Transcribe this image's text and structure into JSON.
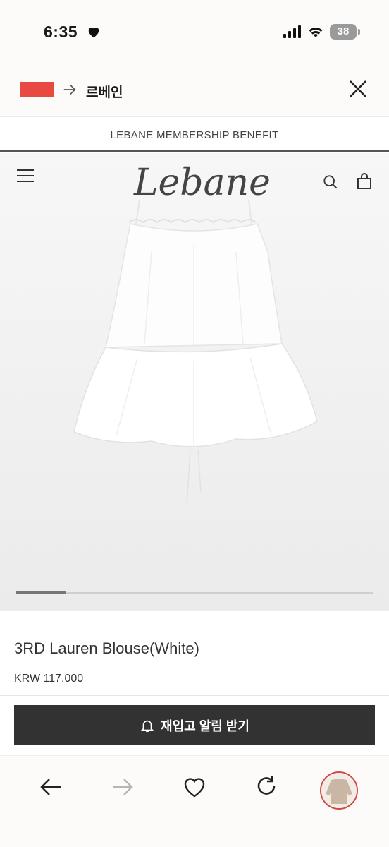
{
  "status_bar": {
    "time": "6:35",
    "battery": "38",
    "icons": [
      "heart-icon",
      "signal-icon",
      "wifi-icon",
      "battery-icon"
    ]
  },
  "browser": {
    "site_name": "르베인",
    "flag_color": "#e84a42",
    "icons": [
      "arrow-right-icon",
      "close-icon"
    ]
  },
  "banner": {
    "text": "LEBANE MEMBERSHIP BENEFIT"
  },
  "header": {
    "logo_text": "Lebane",
    "icons": [
      "menu-icon",
      "search-icon",
      "bag-icon"
    ]
  },
  "carousel": {
    "progress_fraction": 0.14
  },
  "product": {
    "name": "3RD Lauren Blouse(White)",
    "price": "KRW 117,000"
  },
  "restock_button": {
    "label": "재입고 알림 받기"
  },
  "bottom_nav": {
    "items": [
      "back-icon",
      "forward-icon",
      "heart-icon",
      "refresh-icon",
      "product-thumbnail"
    ]
  },
  "colors": {
    "accent": "#e84a42",
    "button_bg": "#333233"
  }
}
